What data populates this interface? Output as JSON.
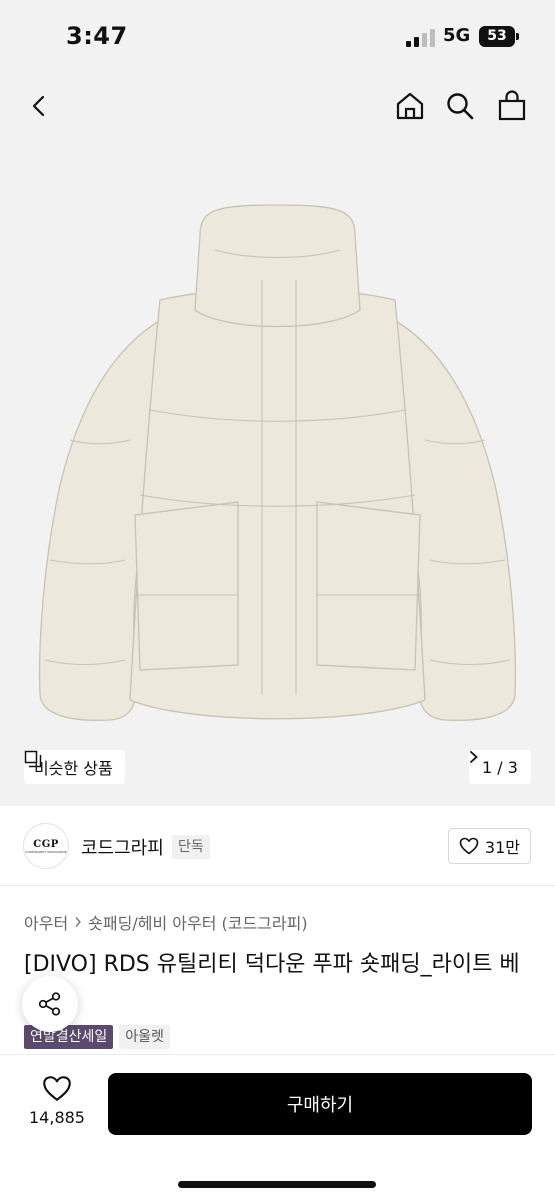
{
  "status_bar": {
    "time": "3:47",
    "network": "5G",
    "battery": "53"
  },
  "nav": {
    "back_icon": "chevron-left-icon",
    "home_icon": "home-icon",
    "search_icon": "search-icon",
    "cart_icon": "shopping-bag-icon"
  },
  "gallery": {
    "similar_label": "비슷한 상품",
    "page_indicator": "1 / 3",
    "jacket_color": "#ece8dc"
  },
  "brand": {
    "logo_text": "CGP",
    "logo_subtext": "CODEGRAPHY WORLDWIDE",
    "name": "코드그라피",
    "badge": "단독",
    "likes": "31만"
  },
  "breadcrumb": {
    "level1": "아우터",
    "level2": "숏패딩/헤비 아우터 (코드그라피)"
  },
  "product": {
    "title": "[DIVO] RDS 유틸리티 덕다운 푸파 숏패딩_라이트 베이지",
    "tags": [
      "연말결산세일",
      "아울렛"
    ]
  },
  "bottom": {
    "wish_count": "14,885",
    "buy_label": "구매하기"
  }
}
